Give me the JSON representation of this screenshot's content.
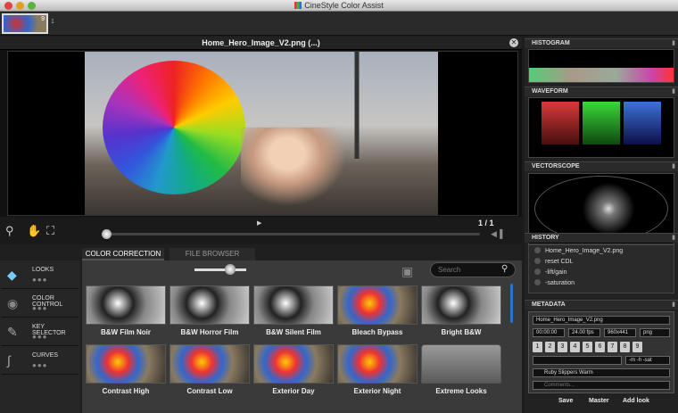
{
  "app": {
    "title": "CineStyle Color Assist"
  },
  "filmstrip": {
    "badge": "9",
    "counter": "1"
  },
  "viewer": {
    "title": "Home_Hero_Image_V2.png (...)",
    "close_icon": "close-icon",
    "page_indicator": "1 / 1",
    "play_icon": "▶"
  },
  "tabs": [
    {
      "label": "COLOR CORRECTION"
    },
    {
      "label": "FILE BROWSER"
    }
  ],
  "sidebar": {
    "items": [
      {
        "label": "LOOKS",
        "icon": "cube-icon"
      },
      {
        "label": "COLOR CONTROL",
        "icon": "color-wheel-icon"
      },
      {
        "label": "KEY SELECTOR",
        "icon": "eyedropper-icon"
      },
      {
        "label": "CURVES",
        "icon": "curve-icon"
      }
    ]
  },
  "search": {
    "placeholder": "Search"
  },
  "looks": [
    {
      "name": "B&W Film Noir",
      "style": "bw"
    },
    {
      "name": "B&W Horror Film",
      "style": "bw"
    },
    {
      "name": "B&W Silent Film",
      "style": "bw"
    },
    {
      "name": "Bleach Bypass",
      "style": "color"
    },
    {
      "name": "Bright B&W",
      "style": "bw"
    },
    {
      "name": "Contrast High",
      "style": "color"
    },
    {
      "name": "Contrast Low",
      "style": "color"
    },
    {
      "name": "Exterior Day",
      "style": "color"
    },
    {
      "name": "Exterior Night",
      "style": "color"
    },
    {
      "name": "Extreme Looks",
      "style": "folder"
    }
  ],
  "panels": {
    "histogram": "HISTOGRAM",
    "waveform": "WAVEFORM",
    "vectorscope": "VECTORSCOPE",
    "history": "HISTORY",
    "metadata": "METADATA"
  },
  "history": {
    "items": [
      "Home_Hero_Image_V2.png",
      "reset CDL",
      "-lift/gain",
      "-saturation"
    ]
  },
  "metadata": {
    "filename": "Home_Hero_Image_V2.png",
    "timecode": "00:00:00",
    "fps": "24.00 fps",
    "resolution": "960x441",
    "format": "png",
    "numbers": [
      "1",
      "2",
      "3",
      "4",
      "5",
      "6",
      "7",
      "8",
      "9"
    ],
    "adjust": "-m -h -sat",
    "look_name": "Ruby Slippers Warm",
    "comments_placeholder": "Comments..."
  },
  "footer": {
    "save": "Save",
    "master": "Master",
    "add_look": "Add look"
  },
  "colors": {
    "accent": "#2a75c7",
    "background": "#1c1c1c"
  }
}
